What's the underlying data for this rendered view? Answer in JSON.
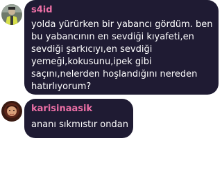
{
  "messages": [
    {
      "username": "s4id",
      "avatar_icon": "profile-photo-icon",
      "lines": [
        "yolda yürürken bir yabancı gördüm. ben",
        "bu yabancının en sevdiği kıyafeti,en",
        "sevdiği şarkıcıyı,en sevdiği",
        "yemeği,kokusunu,ipek gibi",
        "saçını,nelerden hoşlandığını nereden",
        "hatırlıyorum?"
      ]
    },
    {
      "username": "karisinaasik",
      "avatar_icon": "profile-photo-icon",
      "lines": [
        "ananı sıkmıstır ondan"
      ]
    }
  ],
  "colors": {
    "bubble_bg": "#1f1b33",
    "username": "#ec6fa6",
    "text": "#ffffff",
    "page_bg": "#ffffff"
  }
}
